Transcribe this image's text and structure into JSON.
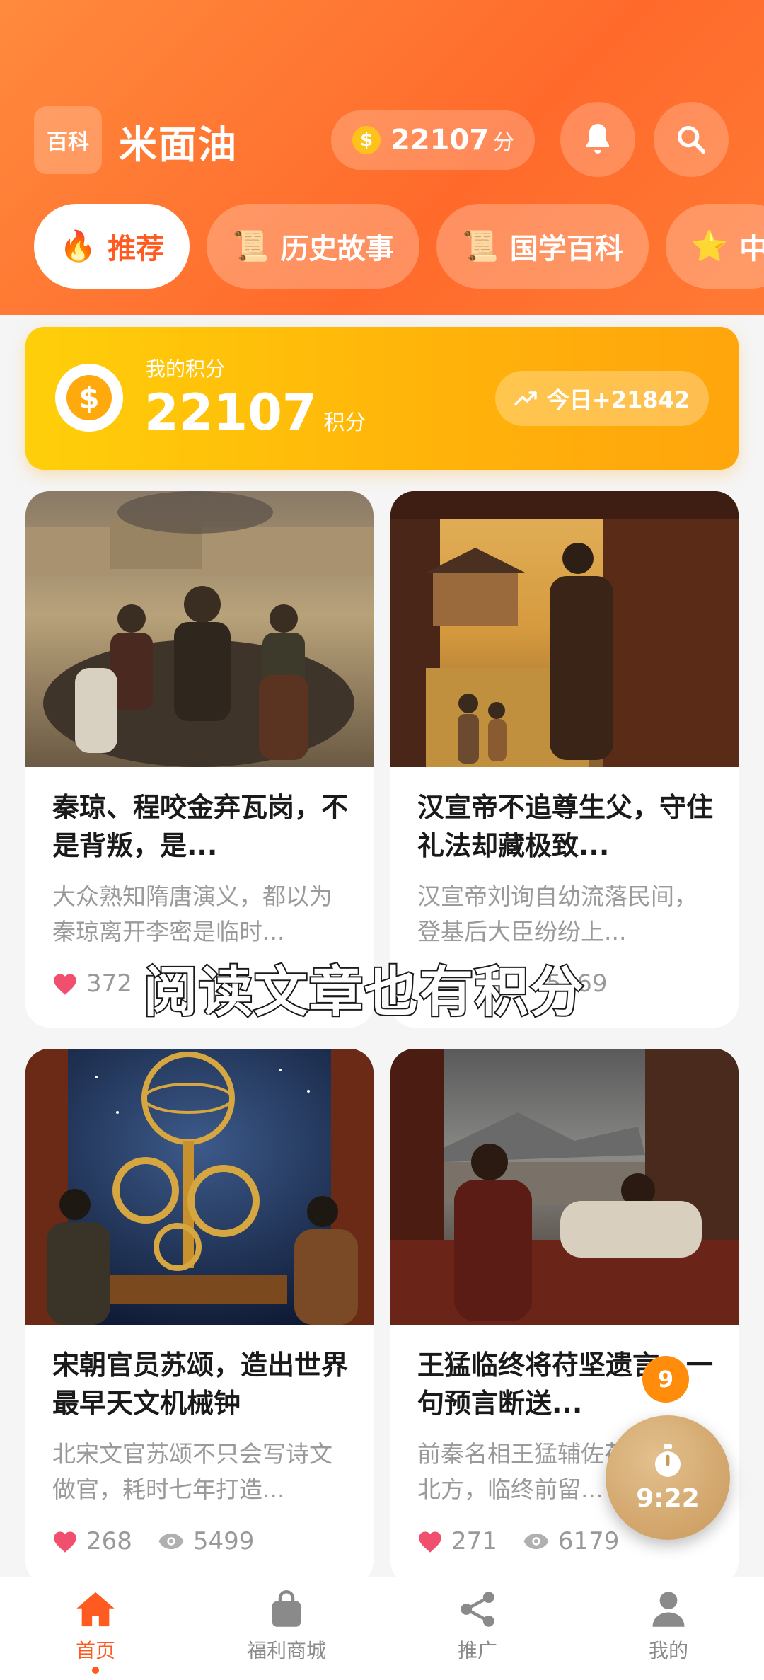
{
  "header": {
    "badge": "百科",
    "title": "米面油",
    "points_value": "22107",
    "points_unit": "分"
  },
  "tabs": [
    {
      "label": "推荐",
      "icon": "fire-icon",
      "glyph": "🔥"
    },
    {
      "label": "历史故事",
      "icon": "scroll-icon",
      "glyph": "📜"
    },
    {
      "label": "国学百科",
      "icon": "scroll-icon",
      "glyph": "📜"
    },
    {
      "label": "中",
      "icon": "star-icon",
      "glyph": "⭐"
    }
  ],
  "points_card": {
    "label": "我的积分",
    "value": "22107",
    "unit": "积分",
    "today": "今日+21842"
  },
  "articles": [
    {
      "title": "秦琼、程咬金弃瓦岗，不是背叛，是...",
      "desc": "大众熟知隋唐演义，都以为秦琼离开李密是临时...",
      "likes": "372",
      "views": ""
    },
    {
      "title": "汉宣帝不追尊生父，守住礼法却藏极致...",
      "desc": "汉宣帝刘询自幼流落民间，登基后大臣纷纷上...",
      "likes": "",
      "views": "5269"
    },
    {
      "title": "宋朝官员苏颂，造出世界最早天文机械钟",
      "desc": "北宋文官苏颂不只会写诗文做官，耗时七年打造...",
      "likes": "268",
      "views": "5499"
    },
    {
      "title": "王猛临终将苻坚遗言，一句预言断送...",
      "desc": "前秦名相王猛辅佐苻坚统一北方，临终前留...",
      "likes": "271",
      "views": "6179"
    }
  ],
  "overlay_caption": "阅读文章也有积分",
  "timer": {
    "badge": "9",
    "time": "9:22"
  },
  "nav": [
    {
      "label": "首页",
      "icon": "home-icon"
    },
    {
      "label": "福利商城",
      "icon": "shopping-bag-icon"
    },
    {
      "label": "推广",
      "icon": "share-icon"
    },
    {
      "label": "我的",
      "icon": "user-icon"
    }
  ],
  "colors": {
    "brand": "#ff6a2b",
    "accent": "#ffb20a",
    "like": "#f0506e"
  }
}
